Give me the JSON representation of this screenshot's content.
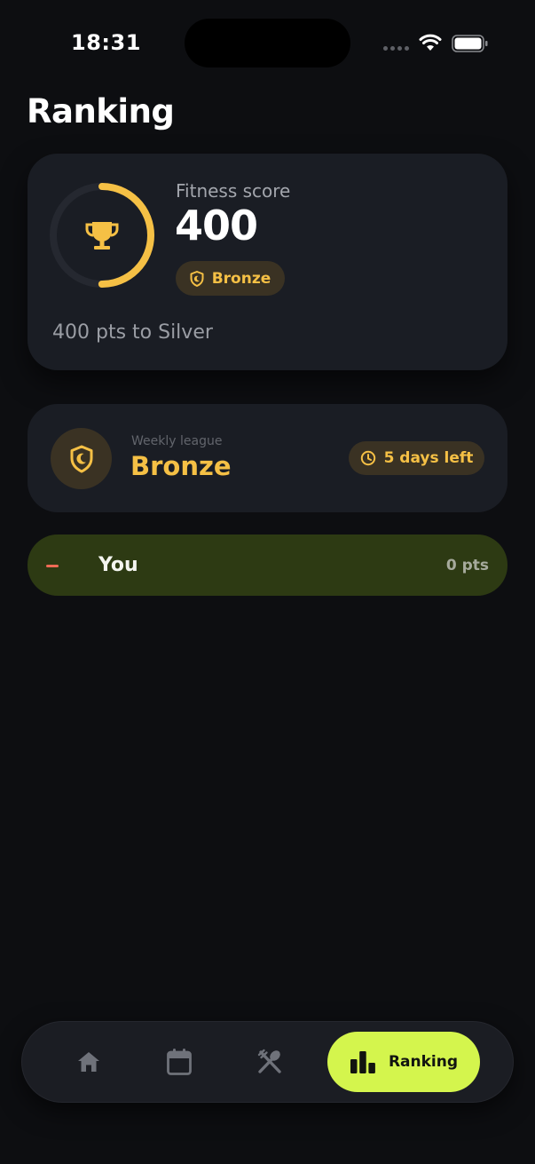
{
  "status_bar": {
    "time": "18:31"
  },
  "page": {
    "title": "Ranking"
  },
  "fitness": {
    "label": "Fitness score",
    "score": "400",
    "tier": "Bronze",
    "progress_text": "400 pts to Silver",
    "ring_progress": 0.5
  },
  "league": {
    "label": "Weekly league",
    "name": "Bronze",
    "time_left": "5 days left"
  },
  "leaderboard": {
    "you": {
      "rank": "–",
      "name": "You",
      "points": "0 pts"
    }
  },
  "nav": {
    "items": [
      {
        "icon": "home-icon"
      },
      {
        "icon": "calendar-icon"
      },
      {
        "icon": "fork-spoon-icon"
      },
      {
        "icon": "bar-chart-icon",
        "label": "Ranking"
      }
    ]
  },
  "colors": {
    "accent": "#d4f54d",
    "gold": "#f5c045",
    "card": "#1a1d24",
    "background": "#0d0e11",
    "you_row": "#2d3a13"
  }
}
